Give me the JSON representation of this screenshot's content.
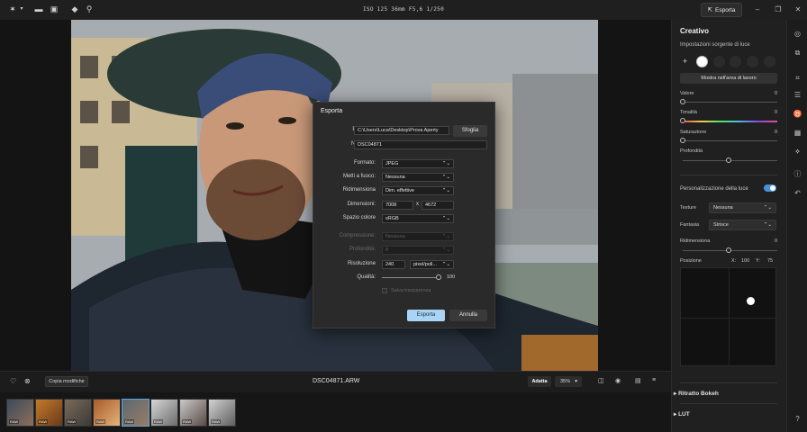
{
  "topbar": {
    "exif": "ISO 125   36mm   F5,6   1/250",
    "export_label": "Esporta",
    "icons": [
      "app-logo-icon",
      "folder-icon",
      "image-icon",
      "eraser-icon",
      "search-icon"
    ]
  },
  "canvas": {
    "filename": "DSC04871.ARW"
  },
  "bottombar": {
    "copy_label": "Copia modifiche",
    "fit_label": "Adatta",
    "zoom": "35%"
  },
  "filmstrip": {
    "raw_badge": "RAW",
    "count": 8,
    "selected_index": 4
  },
  "panel": {
    "title": "Creativo",
    "subtitle": "Impostazioni sorgente di luce",
    "add_symbol": "+",
    "show_btn": "Mostra nell'area di lavoro",
    "sliders": [
      {
        "label": "Valore",
        "value": "0"
      },
      {
        "label": "Tonalità",
        "value": "0"
      },
      {
        "label": "Saturazione",
        "value": "0"
      },
      {
        "label": "Profondità",
        "value": ""
      }
    ],
    "light_custom_label": "Personalizzazione della luce",
    "texture_label": "Texture",
    "texture_value": "Nessuna",
    "fantasia_label": "Fantasia",
    "fantasia_value": "Strisce",
    "resize_label": "Ridimensiona",
    "resize_value": "0",
    "position_label": "Posizione",
    "pos_x_label": "X:",
    "pos_x": "100",
    "pos_y_label": "Y:",
    "pos_y": "75",
    "accordion1": "Ritratto Bokeh",
    "accordion2": "LUT"
  },
  "dialog": {
    "title": "Esporta",
    "path_label": "Percorso:",
    "path_value": "C:\\Users\\Luca\\Desktop\\Prova Aperty",
    "browse_label": "Sfoglia",
    "filename_label": "Nome file:",
    "filename_value": "DSC04871",
    "format_label": "Formato:",
    "format_value": "JPEG",
    "focus_label": "Metti a fuoco:",
    "focus_value": "Nessuna",
    "resize_label": "Ridimensiona",
    "resize_value": "Dim. effettive",
    "dims_label": "Dimensioni:",
    "width": "7008",
    "times": "x",
    "height": "4672",
    "colorspace_label": "Spazio colore",
    "colorspace_value": "sRGB",
    "compression_label": "Compressione:",
    "compression_value": "Nessuna",
    "depth_label": "Profondità:",
    "depth_value": "8",
    "resolution_label": "Risoluzione",
    "resolution_value": "240",
    "resolution_unit": "pixel/poll...",
    "quality_label": "Qualità:",
    "quality_value": "100",
    "save_transparency": "Salva trasparenza",
    "export_btn": "Esporta",
    "cancel_btn": "Annulla"
  },
  "colors": {
    "accent": "#4a90d9",
    "primary_button": "#a9d4f5"
  }
}
